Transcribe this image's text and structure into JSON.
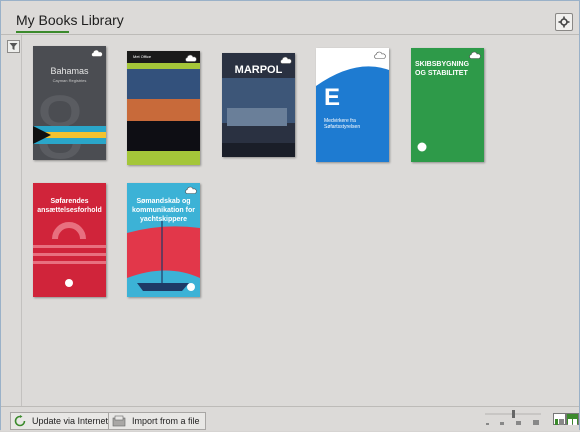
{
  "tabs": [
    {
      "label": "My Books",
      "active": true
    },
    {
      "label": "Library",
      "active": false
    }
  ],
  "books": [
    {
      "title": "Bahamas",
      "subtitle": "Cayman Registries",
      "color": "#4b4d52"
    },
    {
      "title": "Met Office",
      "subtitle": "",
      "color": "#1e1f25"
    },
    {
      "title": "MARPOL",
      "subtitle": "",
      "color": "#2a3141"
    },
    {
      "title": "E",
      "subtitle": "Medvirkere fra Søfartsstyrelsen",
      "color": "#1e7bd1"
    },
    {
      "title": "SKIBSBYGNING OG STABILITET",
      "subtitle": "",
      "color": "#2e9a49"
    },
    {
      "title": "Søfarendes ansættelsesforhold",
      "subtitle": "",
      "color": "#d0243a"
    },
    {
      "title": "Sømandskab og kommunikation for yachtskippere",
      "subtitle": "",
      "color": "#3cb2d6"
    }
  ],
  "footer": {
    "update_label": "Update via Internet",
    "import_label": "Import from a file"
  },
  "colors": {
    "accent": "#3b8a2c",
    "background": "#dcdad8"
  },
  "icons": [
    "gear-icon",
    "filter-icon",
    "cloud-icon",
    "refresh-icon",
    "import-icon",
    "list-view-icon",
    "grid-view-icon"
  ]
}
